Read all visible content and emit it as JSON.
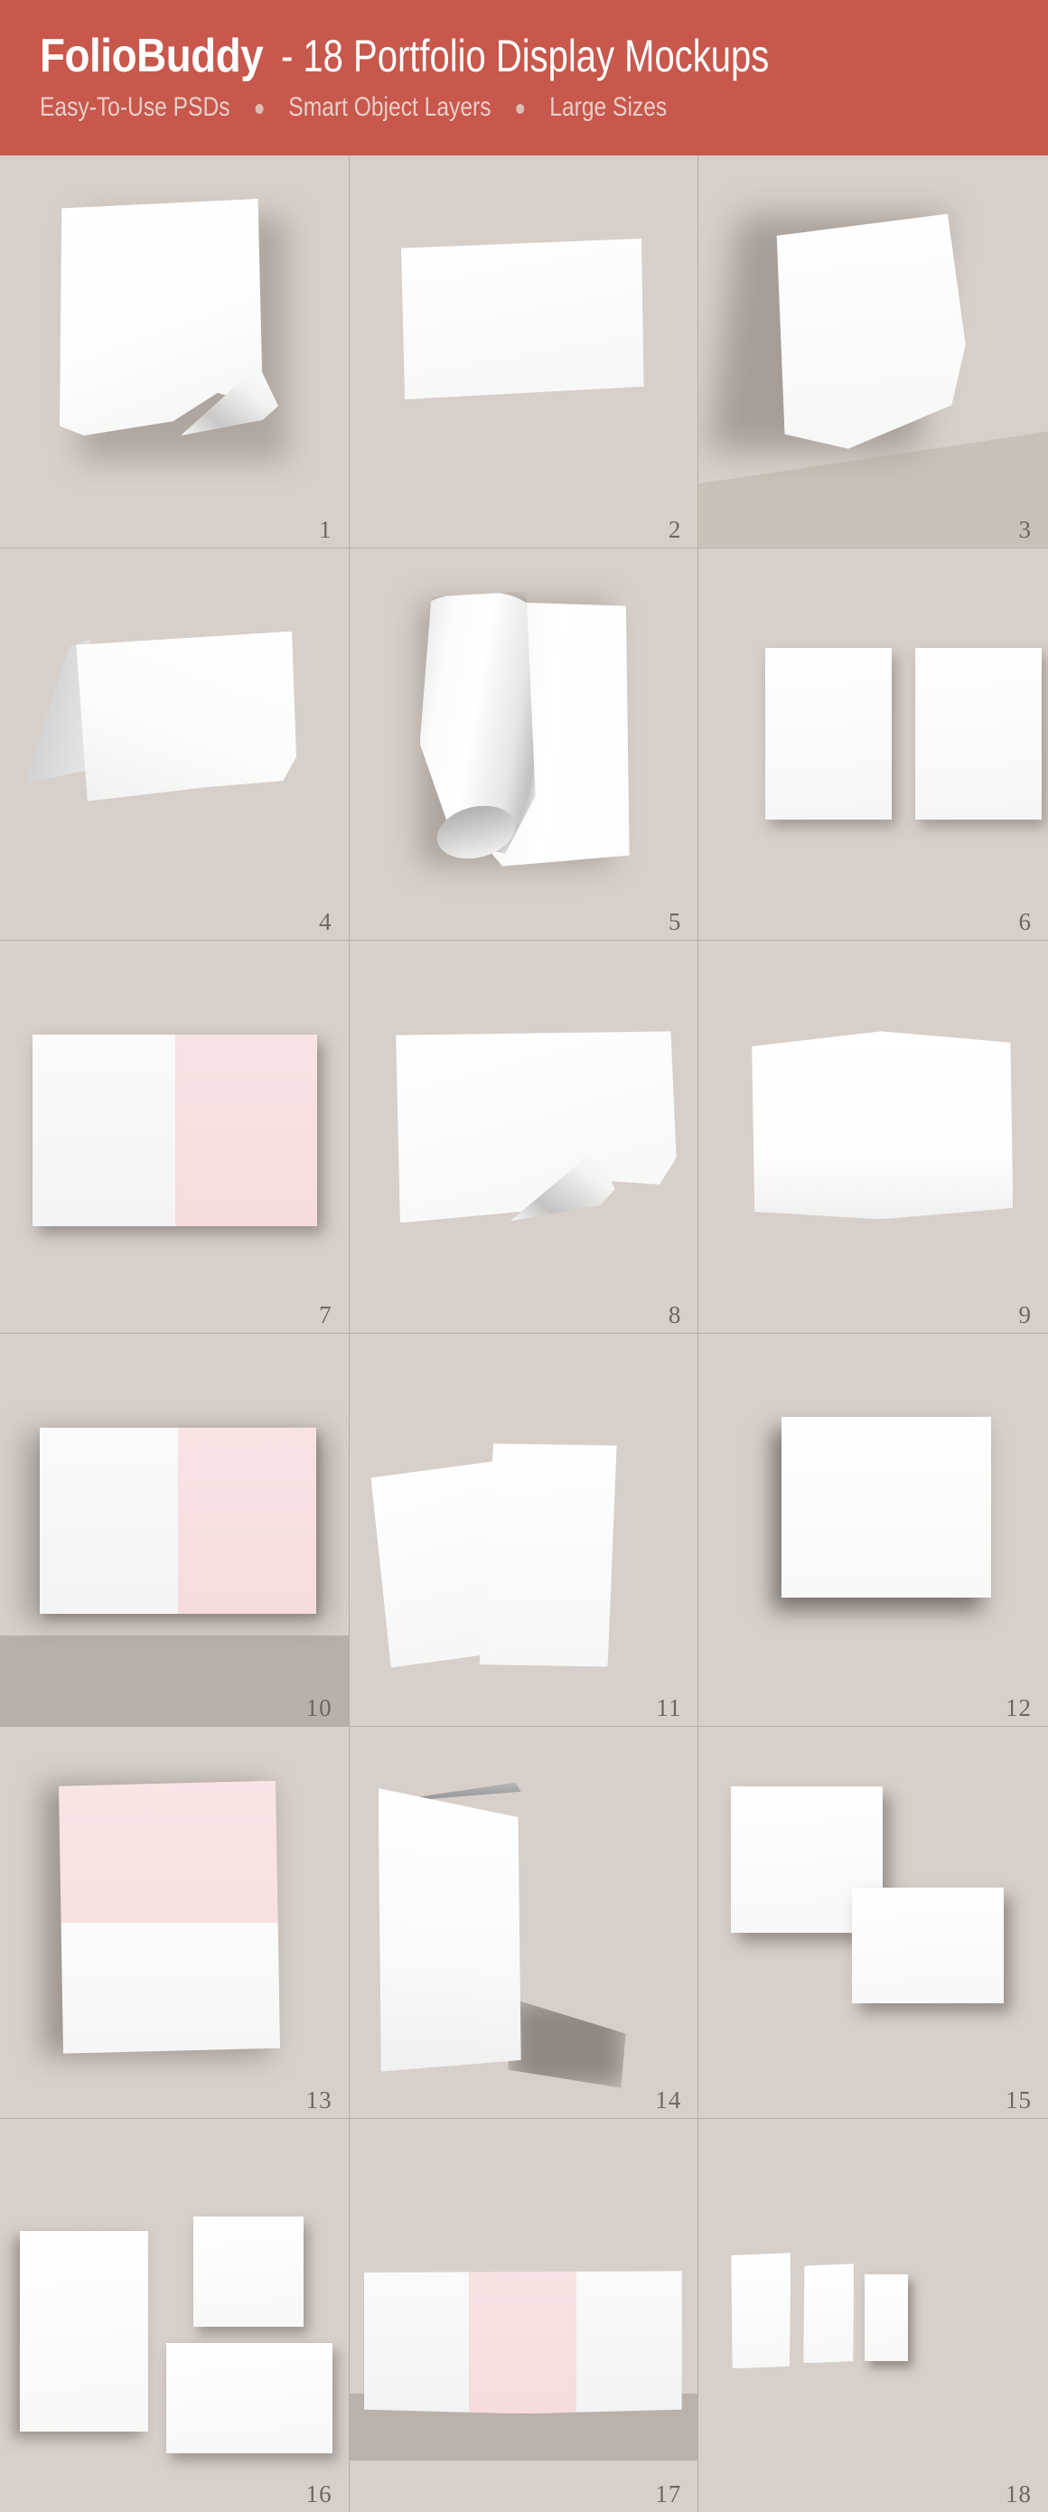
{
  "header": {
    "brand": "FolioBuddy",
    "title_rest": "- 18 Portfolio Display Mockups",
    "features": [
      "Easy-To-Use PSDs",
      "Smart Object Layers",
      "Large Sizes"
    ],
    "bg_color": "#c8574c",
    "text_color": "#ffffff",
    "subtext_color": "#e8cfc9"
  },
  "palette": {
    "canvas": "#d7cfc9",
    "grid_line": "#b7aea7",
    "paper": "#fbfbfa",
    "pink": "#f8e2e3",
    "floor": "#c7bdb6",
    "shelf": "#b9b0a9",
    "number": "#6e6661"
  },
  "grid": {
    "columns": 3,
    "rows": 6,
    "cells": [
      {
        "number": "1",
        "name": "curled-corner-portrait-sheet"
      },
      {
        "number": "2",
        "name": "flat-landscape-sheet"
      },
      {
        "number": "3",
        "name": "leaning-sheet-on-floor"
      },
      {
        "number": "4",
        "name": "folded-tent-card"
      },
      {
        "number": "5",
        "name": "rolled-poster"
      },
      {
        "number": "6",
        "name": "two-portrait-sheets"
      },
      {
        "number": "7",
        "name": "half-pink-landscape-card"
      },
      {
        "number": "8",
        "name": "curled-corner-landscape-sheet"
      },
      {
        "number": "9",
        "name": "wavy-landscape-sheet"
      },
      {
        "number": "10",
        "name": "half-pink-card-on-shelf"
      },
      {
        "number": "11",
        "name": "two-tilted-sheets"
      },
      {
        "number": "12",
        "name": "single-large-sheet"
      },
      {
        "number": "13",
        "name": "pink-white-vertical-sheet"
      },
      {
        "number": "14",
        "name": "standing-folded-card"
      },
      {
        "number": "15",
        "name": "two-overlapping-landscape-sheets"
      },
      {
        "number": "16",
        "name": "three-mixed-sheets"
      },
      {
        "number": "17",
        "name": "pink-center-trifold-on-shelf"
      },
      {
        "number": "18",
        "name": "three-portrait-sheets-row"
      }
    ]
  }
}
